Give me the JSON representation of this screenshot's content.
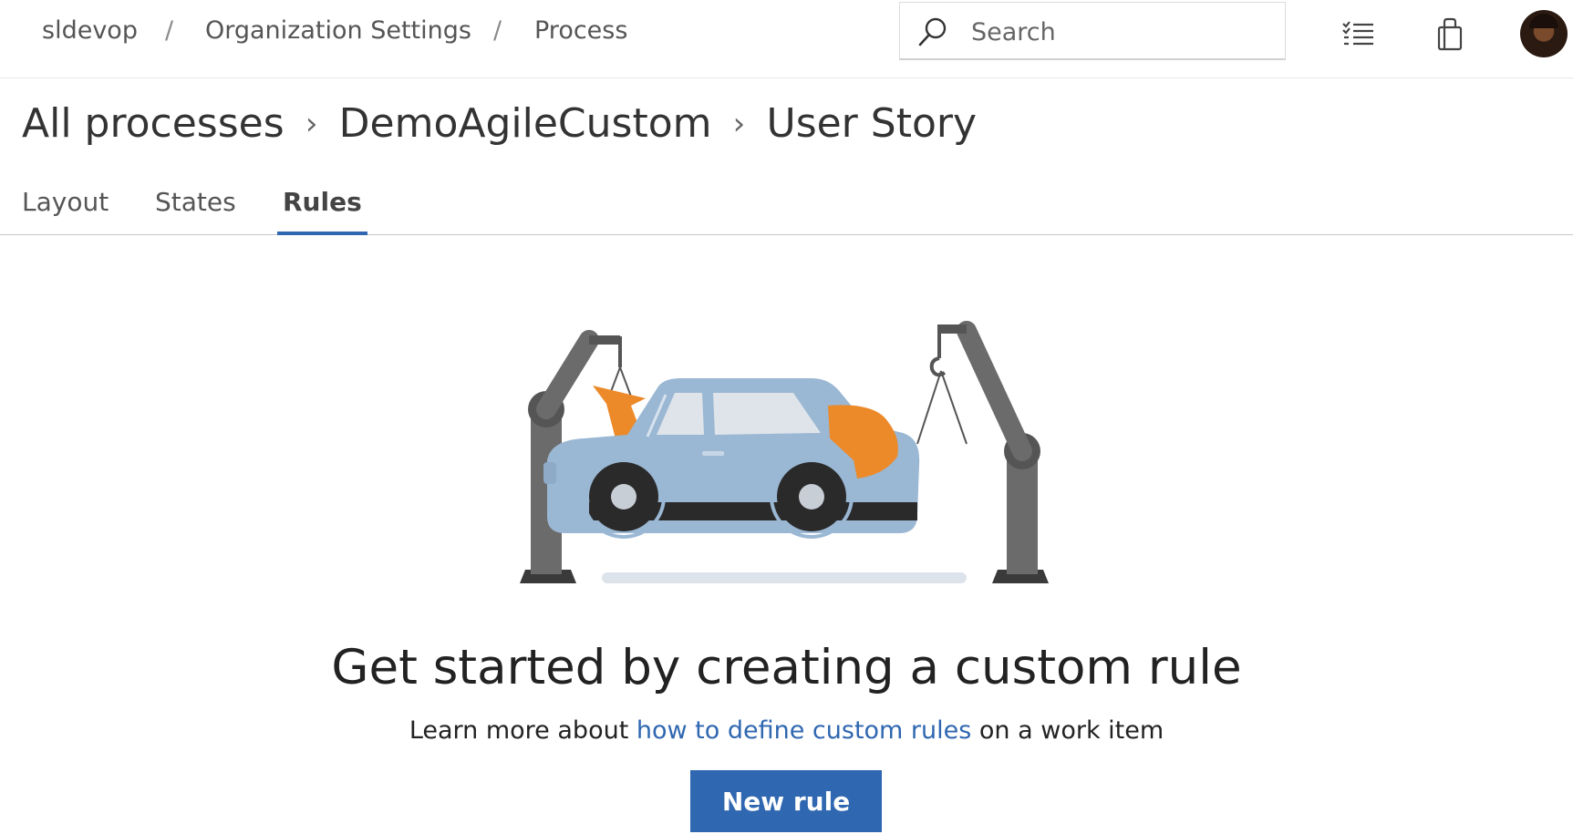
{
  "topbar": {
    "breadcrumb": [
      "sldevop",
      "Organization Settings",
      "Process"
    ],
    "separator": "/",
    "search_placeholder": "Search"
  },
  "process_breadcrumb": [
    "All processes",
    "DemoAgileCustom",
    "User Story"
  ],
  "tabs": [
    {
      "label": "Layout",
      "active": false
    },
    {
      "label": "States",
      "active": false
    },
    {
      "label": "Rules",
      "active": true
    }
  ],
  "empty_state": {
    "headline": "Get started by creating a custom rule",
    "subtext_before": "Learn more about ",
    "link_text": "how to define custom rules",
    "subtext_after": " on a work item",
    "button_label": "New rule"
  },
  "icons": {
    "search": "search-icon",
    "backlog": "list-checklist-icon",
    "marketplace": "shopping-bag-icon",
    "avatar": "user-avatar"
  },
  "colors": {
    "accent": "#2f67b0",
    "car_body": "#9ab7d3",
    "car_part": "#ec8a2a",
    "robot_arm": "#6b6b6b"
  }
}
